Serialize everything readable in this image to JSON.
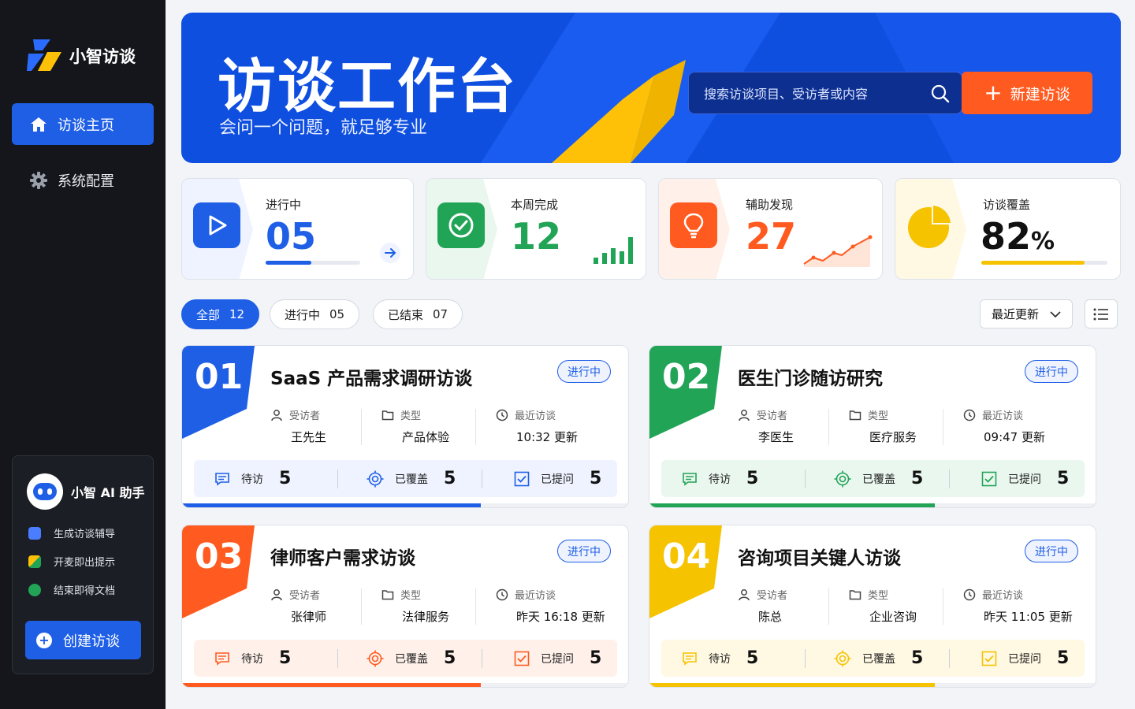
{
  "app": {
    "name": "小智访谈"
  },
  "nav": {
    "home": "访谈主页",
    "settings": "系统配置"
  },
  "assistant": {
    "title": "小智 AI 助手",
    "features": [
      "生成访谈辅导",
      "开麦即出提示",
      "结束即得文档"
    ],
    "create_label": "创建访谈"
  },
  "banner": {
    "title": "访谈工作台",
    "subtitle": "会问一个问题，就足够专业",
    "search_placeholder": "搜索访谈项目、受访者或内容",
    "new_label": "新建访谈"
  },
  "stats": [
    {
      "label": "进行中",
      "value": "05",
      "progress": 0.48,
      "color": "#1f5fe6"
    },
    {
      "label": "本周完成",
      "value": "12",
      "color": "#22a456"
    },
    {
      "label": "辅助发现",
      "value": "27",
      "color": "#ff5a1f"
    },
    {
      "label": "访谈覆盖",
      "value": "82",
      "unit": "%",
      "progress": 0.82,
      "color": "#f6c300"
    }
  ],
  "filters": {
    "all": {
      "label": "全部",
      "count": "12"
    },
    "ongoing": {
      "label": "进行中",
      "count": "05"
    },
    "ended": {
      "label": "已结束",
      "count": "07"
    },
    "sort_label": "最近更新"
  },
  "labels": {
    "interviewee": "受访者",
    "type": "类型",
    "recent": "最近访谈",
    "pending": "待访",
    "covered": "已覆盖",
    "asked": "已提问"
  },
  "cards": [
    {
      "no": "01",
      "title": "SaaS 产品需求调研访谈",
      "status": "进行中",
      "interviewee": "王先生",
      "type": "产品体验",
      "recent": "10:32 更新",
      "pending": "5",
      "covered": "5",
      "asked": "5",
      "color": "#1f5fe6",
      "tint": "#eef3ff",
      "progress": 0.67
    },
    {
      "no": "02",
      "title": "医生门诊随访研究",
      "status": "进行中",
      "interviewee": "李医生",
      "type": "医疗服务",
      "recent": "09:47 更新",
      "pending": "5",
      "covered": "5",
      "asked": "5",
      "color": "#22a456",
      "tint": "#eaf7ef",
      "progress": 0.64
    },
    {
      "no": "03",
      "title": "律师客户需求访谈",
      "status": "进行中",
      "interviewee": "张律师",
      "type": "法律服务",
      "recent": "昨天 16:18 更新",
      "pending": "5",
      "covered": "5",
      "asked": "5",
      "color": "#ff5a1f",
      "tint": "#fff1ea",
      "progress": 0.67
    },
    {
      "no": "04",
      "title": "咨询项目关键人访谈",
      "status": "进行中",
      "interviewee": "陈总",
      "type": "企业咨询",
      "recent": "昨天 11:05 更新",
      "pending": "5",
      "covered": "5",
      "asked": "5",
      "color": "#f6c300",
      "tint": "#fff8e3",
      "progress": 0.64
    }
  ]
}
